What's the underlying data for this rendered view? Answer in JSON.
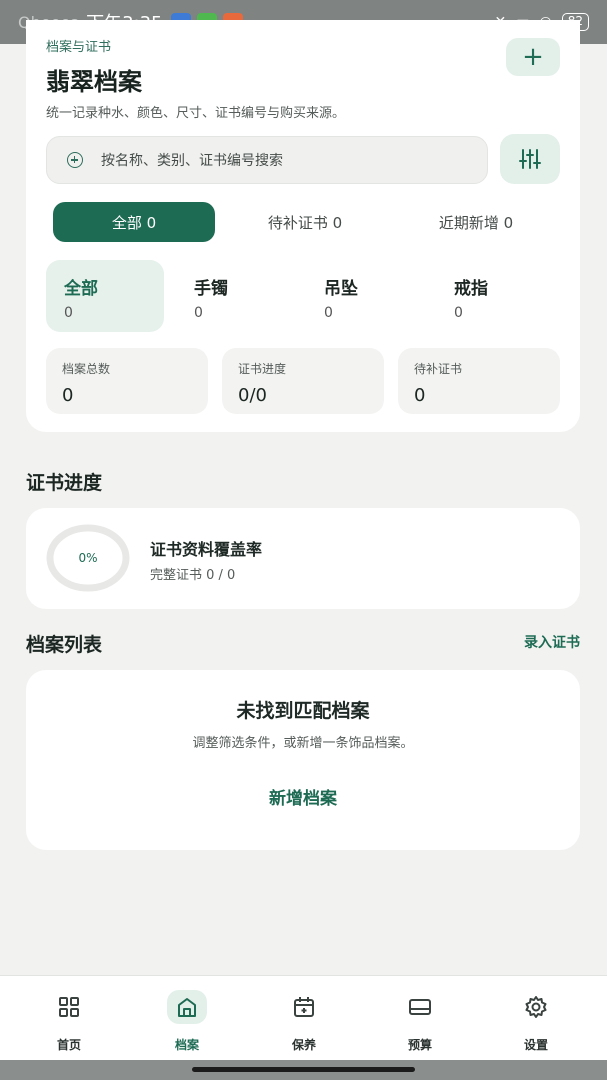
{
  "status_bar": {
    "carrier": "Qbeeea",
    "time": "下午3:35",
    "battery": "82"
  },
  "header": {
    "eyebrow": "档案与证书",
    "title": "翡翠档案",
    "description": "统一记录种水、颜色、尺寸、证书编号与购买来源。",
    "add_label": "+"
  },
  "search": {
    "placeholder": "按名称、类别、证书编号搜索"
  },
  "segments": [
    {
      "label": "全部 0"
    },
    {
      "label": "待补证书 0"
    },
    {
      "label": "近期新增 0"
    }
  ],
  "categories": [
    {
      "label": "全部",
      "count": "0"
    },
    {
      "label": "手镯",
      "count": "0"
    },
    {
      "label": "吊坠",
      "count": "0"
    },
    {
      "label": "戒指",
      "count": "0"
    }
  ],
  "stats": [
    {
      "label": "档案总数",
      "value": "0"
    },
    {
      "label": "证书进度",
      "value": "0/0"
    },
    {
      "label": "待补证书",
      "value": "0"
    }
  ],
  "certificate_progress": {
    "section_title": "证书进度",
    "percent": "0%",
    "coverage": 0,
    "title": "证书资料覆盖率",
    "subtitle": "完整证书 0 / 0"
  },
  "archive_list": {
    "section_title": "档案列表",
    "link": "录入证书",
    "empty_title": "未找到匹配档案",
    "empty_desc": "调整筛选条件，或新增一条饰品档案。",
    "empty_action": "新增档案"
  },
  "bottom_nav": [
    {
      "label": "首页",
      "icon": "grid-icon"
    },
    {
      "label": "档案",
      "icon": "archive-icon"
    },
    {
      "label": "保养",
      "icon": "calendar-icon"
    },
    {
      "label": "预算",
      "icon": "wallet-icon"
    },
    {
      "label": "设置",
      "icon": "gear-icon"
    }
  ],
  "colors": {
    "accent": "#1e6b54",
    "accent_light": "#e3efe9",
    "background": "#f2f3f1"
  }
}
